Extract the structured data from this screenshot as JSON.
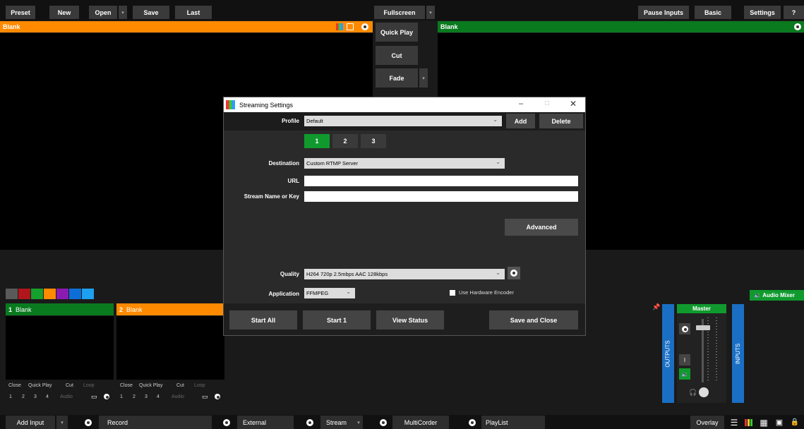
{
  "topbar": {
    "preset": "Preset",
    "new": "New",
    "open": "Open",
    "save": "Save",
    "last": "Last",
    "fullscreen": "Fullscreen",
    "pause_inputs": "Pause Inputs",
    "basic": "Basic",
    "settings": "Settings",
    "help": "?"
  },
  "preview": {
    "title": "Blank"
  },
  "output": {
    "title": "Blank"
  },
  "transitions": {
    "quick_play": "Quick Play",
    "cut": "Cut",
    "fade": "Fade"
  },
  "colors": {
    "preview_bar": "#ff8a00",
    "output_bar": "#0a7a1f",
    "accent_green": "#109a2e",
    "blue_panel": "#1a6fc4",
    "swatches": [
      "#5a5a5a",
      "#b0161c",
      "#16a02e",
      "#ff8a00",
      "#8b1bb0",
      "#0c6fd8",
      "#1ea0f0"
    ]
  },
  "inputs": [
    {
      "number": "1",
      "name": "Blank",
      "actions": [
        "Close",
        "Quick Play",
        "Cut",
        "Loop"
      ],
      "numbers": [
        "1",
        "2",
        "3",
        "4"
      ],
      "audio": "Audio"
    },
    {
      "number": "2",
      "name": "Blank",
      "actions": [
        "Close",
        "Quick Play",
        "Cut",
        "Loop"
      ],
      "numbers": [
        "1",
        "2",
        "3",
        "4"
      ],
      "audio": "Audio"
    }
  ],
  "mixer": {
    "label": "Audio Mixer",
    "master": "Master",
    "outputs": "OUTPUTS",
    "inputs": "INPUTS",
    "i_button": "I"
  },
  "dialog": {
    "title": "Streaming Settings",
    "profile_label": "Profile",
    "profile_value": "Default",
    "add": "Add",
    "delete": "Delete",
    "tabs": [
      "1",
      "2",
      "3"
    ],
    "destination_label": "Destination",
    "destination_value": "Custom RTMP Server",
    "url_label": "URL",
    "url_value": "",
    "key_label": "Stream Name or Key",
    "key_value": "",
    "advanced": "Advanced",
    "quality_label": "Quality",
    "quality_value": "H264 720p 2.5mbps AAC 128kbps",
    "application_label": "Application",
    "application_value": "FFMPEG",
    "hw_encoder": "Use Hardware Encoder",
    "start_all": "Start All",
    "start_1": "Start 1",
    "view_status": "View Status",
    "save_close": "Save and Close"
  },
  "bottombar": {
    "add_input": "Add Input",
    "record": "Record",
    "external": "External",
    "stream": "Stream",
    "multicorder": "MultiCorder",
    "playlist": "PlayList",
    "overlay": "Overlay"
  }
}
